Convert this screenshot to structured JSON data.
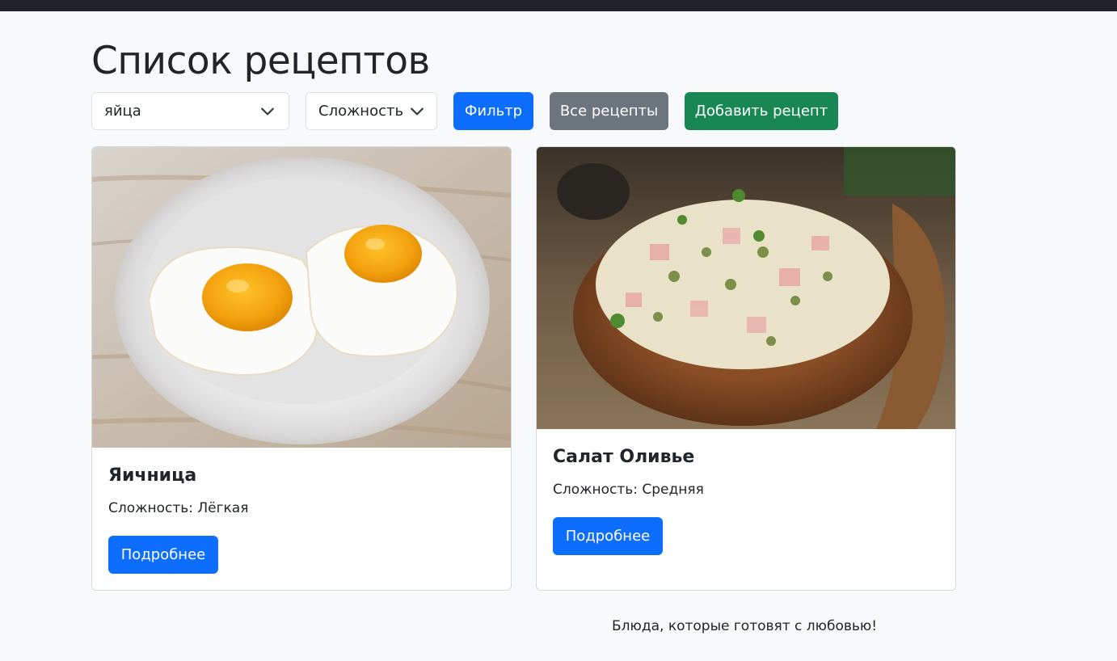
{
  "page": {
    "title": "Список рецептов",
    "footer_text": "Блюда, которые готовят с любовью!"
  },
  "filters": {
    "ingredient_value": "яйца",
    "difficulty_value": "Сложность",
    "filter_label": "Фильтр",
    "all_label": "Все рецепты",
    "add_label": "Добавить рецепт"
  },
  "recipes": [
    {
      "title": "Яичница",
      "difficulty": "Сложность: Лёгкая",
      "details_label": "Подробнее",
      "image": "fried-eggs-photo"
    },
    {
      "title": "Салат Оливье",
      "difficulty": "Сложность: Средняя",
      "details_label": "Подробнее",
      "image": "olivier-salad-photo"
    }
  ],
  "colors": {
    "primary": "#0d6efd",
    "secondary": "#6c757d",
    "success": "#198754",
    "background": "#f8f9fa",
    "topbar": "#1e2125"
  }
}
